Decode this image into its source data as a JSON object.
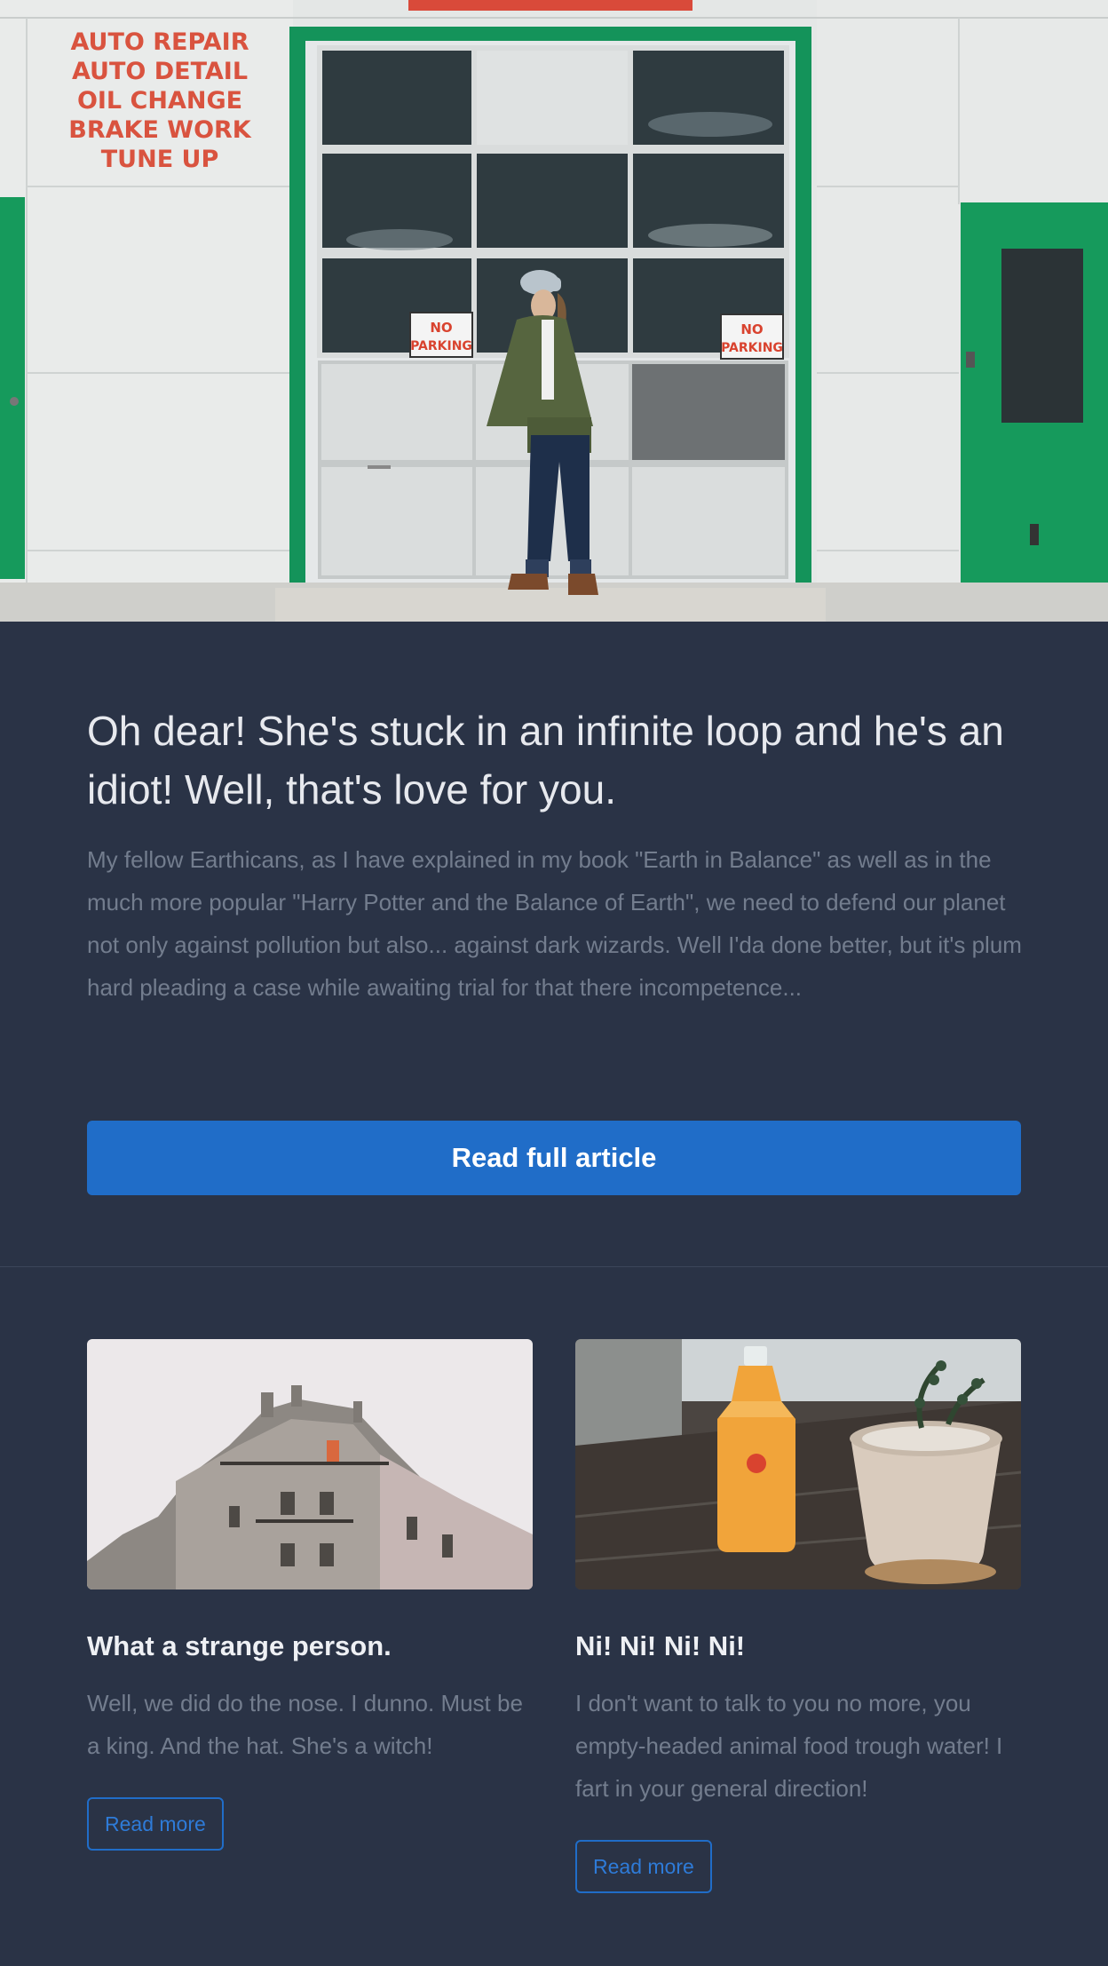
{
  "hero": {
    "image_alt": "Man in a cap and green jacket standing in front of a white garage door with green trim",
    "sign_lines": [
      "AUTO REPAIR",
      "AUTO DETAIL",
      "OIL CHANGE",
      "BRAKE WORK",
      "TUNE UP"
    ],
    "no_parking_line1": "NO",
    "no_parking_line2": "PARKING",
    "title": "Oh dear! She's stuck in an infinite loop and he's an idiot! Well, that's love for you.",
    "body": "My fellow Earthicans, as I have explained in my book \"Earth in Balance\" as well as in the much more popular \"Harry Potter and the Balance of Earth\", we need to defend our planet not only against pollution but also... against dark wizards. Well I'da done better, but it's plum hard pleading a case while awaiting trial for that there incompetence...",
    "button_label": "Read full article"
  },
  "cards": [
    {
      "image_alt": "Corner of a Parisian apartment building against a pale sky",
      "title": "What a strange person.",
      "body": "Well, we did do the nose. I dunno. Must be a king. And the hat. She's a witch!",
      "button_label": "Read more"
    },
    {
      "image_alt": "Bottle of orange juice beside a small potted succulent on a wooden table",
      "title": "Ni! Ni! Ni! Ni!",
      "body": "I don't want to talk to you no more, you empty-headed animal food trough water! I fart in your general direction!",
      "button_label": "Read more"
    }
  ],
  "colors": {
    "background": "#2a3346",
    "accent": "#206dc8",
    "heading": "#e7e9ee",
    "muted_text": "#737d8e"
  }
}
